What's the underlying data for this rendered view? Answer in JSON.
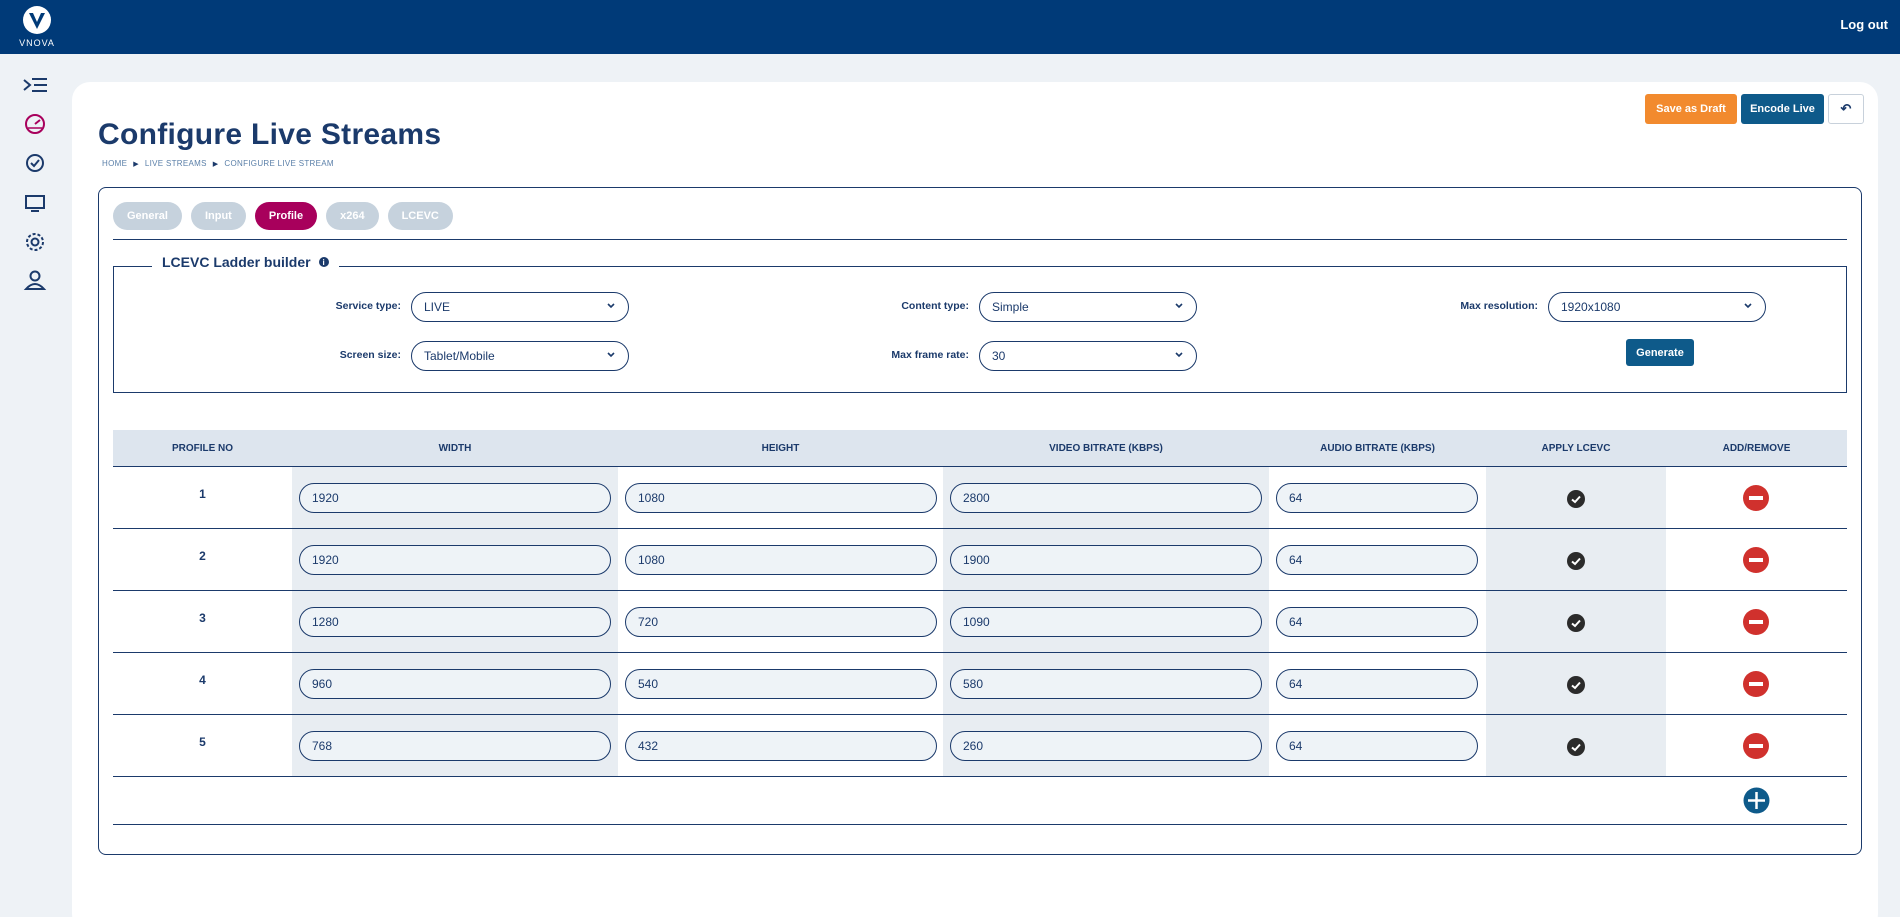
{
  "header": {
    "logo_text": "VNOVA",
    "logout_label": "Log out"
  },
  "sidebar": {
    "icons": [
      "menu-expand-icon",
      "dashboard-gauge-icon",
      "check-circle-icon",
      "monitor-icon",
      "gear-icon",
      "user-icon"
    ]
  },
  "page": {
    "title": "Configure Live Streams",
    "breadcrumb": [
      "HOME",
      "LIVE STREAMS",
      "CONFIGURE LIVE STREAM"
    ],
    "buttons": {
      "save_draft": "Save as Draft",
      "encode_live": "Encode Live",
      "back": "↶"
    }
  },
  "tabs": [
    {
      "label": "General",
      "active": false
    },
    {
      "label": "Input",
      "active": false
    },
    {
      "label": "Profile",
      "active": true
    },
    {
      "label": "x264",
      "active": false
    },
    {
      "label": "LCEVC",
      "active": false
    }
  ],
  "ladder": {
    "title": "LCEVC Ladder builder",
    "fields": {
      "service_type": {
        "label": "Service type:",
        "value": "LIVE"
      },
      "content_type": {
        "label": "Content type:",
        "value": "Simple"
      },
      "max_resolution": {
        "label": "Max resolution:",
        "value": "1920x1080"
      },
      "screen_size": {
        "label": "Screen size:",
        "value": "Tablet/Mobile"
      },
      "max_frame_rate": {
        "label": "Max frame rate:",
        "value": "30"
      }
    },
    "generate_label": "Generate"
  },
  "table": {
    "headers": [
      "PROFILE NO",
      "WIDTH",
      "HEIGHT",
      "VIDEO BITRATE (KBPS)",
      "AUDIO BITRATE (KBPS)",
      "APPLY LCEVC",
      "ADD/REMOVE"
    ],
    "rows": [
      {
        "no": "1",
        "width": "1920",
        "height": "1080",
        "video": "2800",
        "audio": "64",
        "lcevc": true
      },
      {
        "no": "2",
        "width": "1920",
        "height": "1080",
        "video": "1900",
        "audio": "64",
        "lcevc": true
      },
      {
        "no": "3",
        "width": "1280",
        "height": "720",
        "video": "1090",
        "audio": "64",
        "lcevc": true
      },
      {
        "no": "4",
        "width": "960",
        "height": "540",
        "video": "580",
        "audio": "64",
        "lcevc": true
      },
      {
        "no": "5",
        "width": "768",
        "height": "432",
        "video": "260",
        "audio": "64",
        "lcevc": true
      }
    ]
  },
  "colors": {
    "brand": "#003a78",
    "accent_tab": "#a8005c",
    "draft": "#f28a2e",
    "primary_btn": "#0e5a8a",
    "remove": "#d0312d"
  }
}
